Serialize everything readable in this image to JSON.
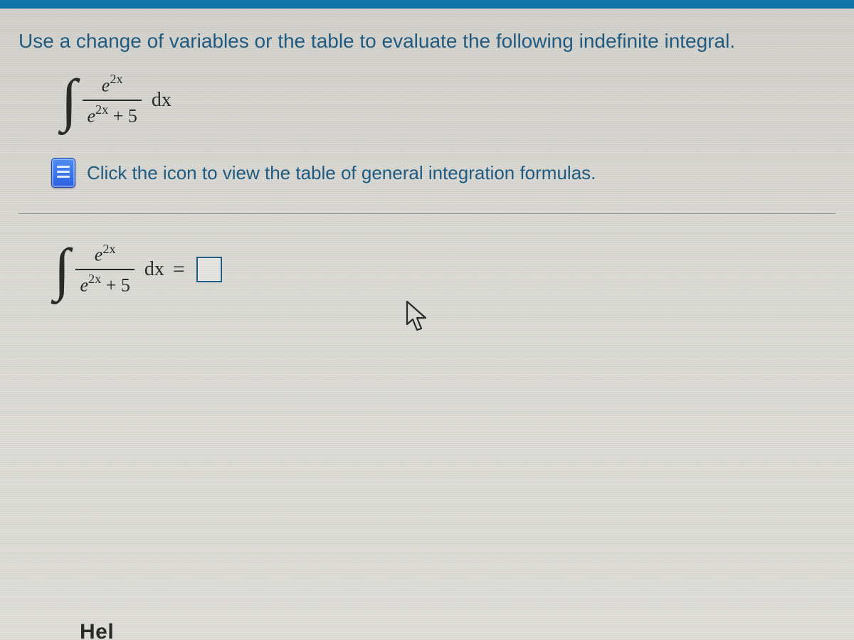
{
  "prompt": "Use a change of variables or the table to evaluate the following indefinite integral.",
  "integral": {
    "numerator_base": "e",
    "numerator_exp": "2x",
    "denominator_base": "e",
    "denominator_exp": "2x",
    "denominator_tail": " + 5",
    "differential": "dx"
  },
  "link_text": "Click the icon to view the table of general integration formulas.",
  "answer": {
    "equals": "=",
    "value": ""
  },
  "footer_fragment": "Hel"
}
